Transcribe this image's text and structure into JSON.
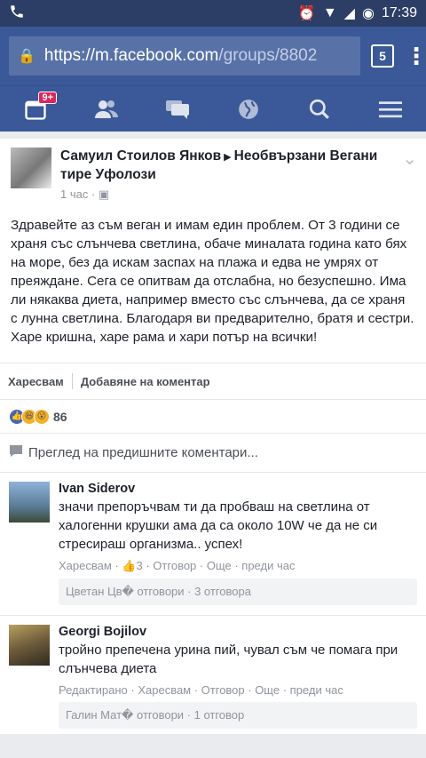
{
  "status": {
    "time": "17:39"
  },
  "browser": {
    "url_host": "https://m.facebook.com",
    "url_path": "/groups/8802",
    "tab_count": "5"
  },
  "nav": {
    "notifications_badge": "9+"
  },
  "post": {
    "author": "Самуил Стоилов Янков",
    "group": "Необвързани Вегани тире Уфолози",
    "time": "1 час",
    "text": "Здравейте аз съм веган и имам един проблем. От 3 години се храня със слънчева светлина, обаче миналата година като бях на море, без да искам заспах на плажа и едва не умрях от преяждане. Сега се опитвам да отслабна, но безуспешно. Има ли някаква диета, например вместо със слънчева, да се храня с лунна светлина. Благодаря ви предварително, братя и сестри. Харе кришна, харе рама и хари потър на всички!",
    "like_label": "Харесвам",
    "comment_label": "Добавяне на коментар",
    "reaction_count": "86",
    "prev_comments_label": "Преглед на предишните коментари..."
  },
  "comments": [
    {
      "name": "Ivan Siderov",
      "text": "значи препоръчвам ти да пробваш на светлина от халогенни крушки ама да са около 10W че да не си стресираш организма.. успех!",
      "meta": "Харесвам · 👍3 · Отговор · Още · преди час",
      "replies": "Цветан Цв� отговори · 3 отговора"
    },
    {
      "name": "Georgi Bojilov",
      "text": "тройно препечена урина пий, чувал съм че помага при слънчева диета",
      "meta": "Редактирано · Харесвам · Отговор · Още · преди час",
      "replies": "Галин Мат� отговори · 1 отговор"
    }
  ]
}
